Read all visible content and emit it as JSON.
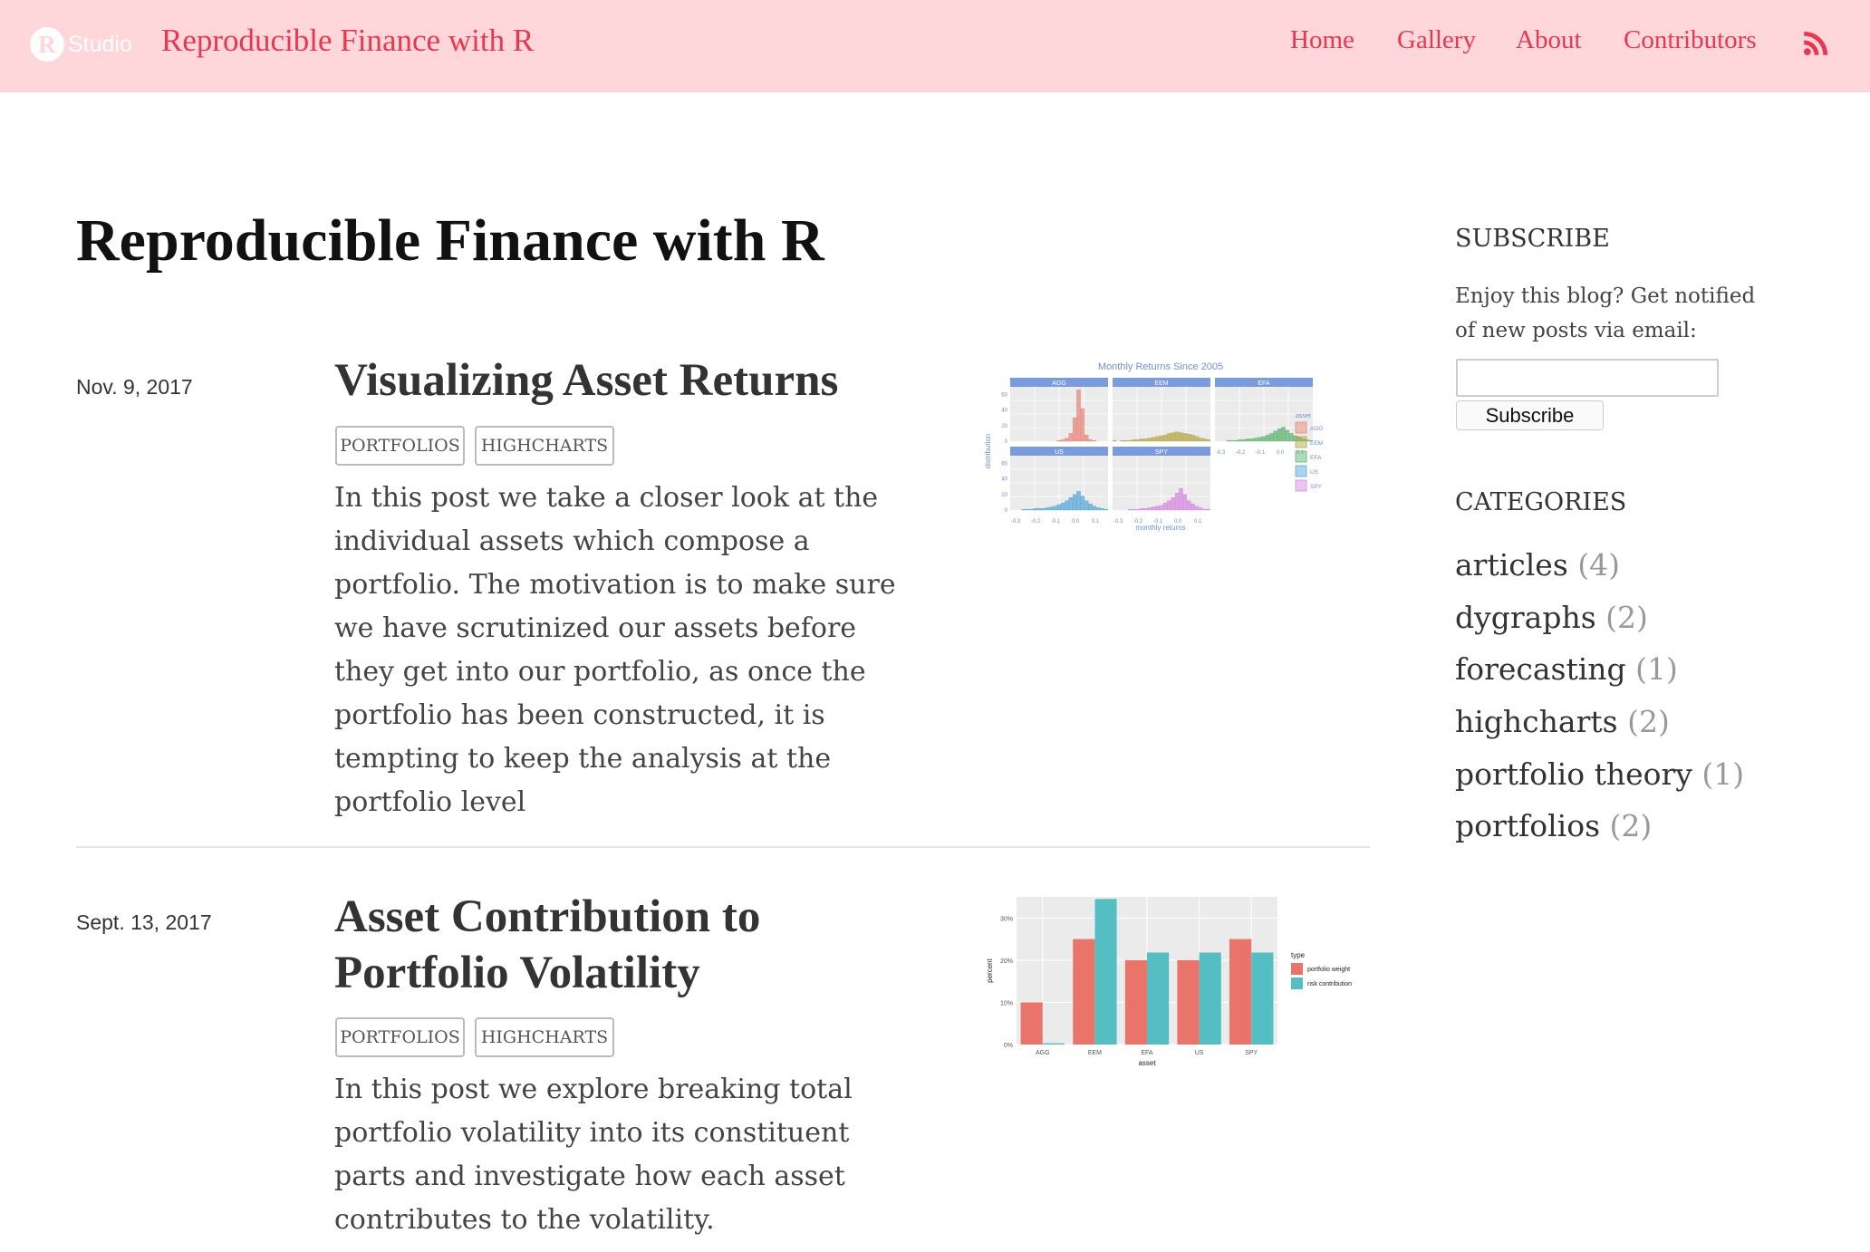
{
  "nav": {
    "logo_letter": "R",
    "logo_text": "Studio",
    "site_title": "Reproducible Finance with R",
    "links": [
      "Home",
      "Gallery",
      "About",
      "Contributors"
    ],
    "rss_icon": "rss-icon",
    "accent_color": "#e8384f",
    "background_color": "#ffd6da"
  },
  "main": {
    "heading": "Reproducible Finance with R",
    "posts": [
      {
        "date": "Nov. 9, 2017",
        "title": "Visualizing Asset Returns",
        "tags": [
          "PORTFOLIOS",
          "HIGHCHARTS"
        ],
        "summary": "In this post we take a closer look at the individual assets which compose a portfolio. The motivation is to make sure we have scrutinized our assets before they get into our portfolio, as once the portfolio has been constructed, it is tempting to keep the analysis at the portfolio level"
      },
      {
        "date": "Sept. 13, 2017",
        "title": "Asset Contribution to Portfolio Volatility",
        "tags": [
          "PORTFOLIOS",
          "HIGHCHARTS"
        ],
        "summary": "In this post we explore breaking total portfolio volatility into its constituent parts and investigate how each asset contributes to the volatility."
      }
    ]
  },
  "sidebar": {
    "subscribe_heading": "SUBSCRIBE",
    "subscribe_text": "Enjoy this blog? Get notified of new posts via email:",
    "subscribe_button": "Subscribe",
    "categories_heading": "CATEGORIES",
    "categories": [
      {
        "name": "articles",
        "count": "(4)"
      },
      {
        "name": "dygraphs",
        "count": "(2)"
      },
      {
        "name": "forecasting",
        "count": "(1)"
      },
      {
        "name": "highcharts",
        "count": "(2)"
      },
      {
        "name": "portfolio theory",
        "count": "(1)"
      },
      {
        "name": "portfolios",
        "count": "(2)"
      }
    ]
  },
  "chart_data": [
    {
      "type": "bar",
      "title": "Monthly Returns Since 2005",
      "xlabel": "monthly returns",
      "ylabel": "distribution",
      "panels": [
        "AGG",
        "EEM",
        "EFA",
        "US",
        "SPY"
      ],
      "x_ticks": [
        "-0.3",
        "-0.2",
        "-0.1",
        "0.0",
        "0.1"
      ],
      "y_ticks": [
        "0",
        "20",
        "40",
        "60"
      ],
      "legend_title": "asset",
      "series": [
        {
          "name": "AGG",
          "color": "#e8877c",
          "values": [
            0,
            0,
            0,
            0,
            0,
            0,
            0,
            0,
            0,
            0,
            0,
            0,
            1,
            2,
            4,
            10,
            30,
            66,
            42,
            8,
            2,
            1,
            0,
            0,
            0
          ]
        },
        {
          "name": "EEM",
          "color": "#b5a94a",
          "values": [
            1,
            0,
            1,
            1,
            1,
            2,
            2,
            3,
            3,
            4,
            5,
            6,
            7,
            8,
            10,
            11,
            12,
            11,
            10,
            9,
            8,
            6,
            4,
            3,
            2
          ]
        },
        {
          "name": "EFA",
          "color": "#62b670",
          "values": [
            0,
            0,
            0,
            1,
            1,
            1,
            2,
            2,
            3,
            3,
            4,
            5,
            6,
            8,
            10,
            13,
            16,
            18,
            14,
            10,
            7,
            5,
            3,
            2,
            1
          ]
        },
        {
          "name": "US",
          "color": "#5aa9d9",
          "values": [
            0,
            0,
            0,
            1,
            1,
            1,
            2,
            2,
            2,
            3,
            4,
            5,
            7,
            9,
            12,
            16,
            20,
            24,
            18,
            12,
            8,
            5,
            3,
            2,
            1
          ]
        },
        {
          "name": "SPY",
          "color": "#d58be0",
          "values": [
            0,
            0,
            0,
            0,
            1,
            1,
            1,
            2,
            2,
            3,
            4,
            5,
            6,
            9,
            12,
            16,
            22,
            28,
            20,
            12,
            8,
            5,
            3,
            1,
            1
          ]
        }
      ]
    },
    {
      "type": "bar",
      "xlabel": "asset",
      "ylabel": "percent",
      "categories": [
        "AGG",
        "EEM",
        "EFA",
        "US",
        "SPY"
      ],
      "y_ticks": [
        "0%",
        "10%",
        "20%",
        "30%"
      ],
      "ylim": [
        0,
        0.35
      ],
      "legend_title": "type",
      "series": [
        {
          "name": "portfolio weight",
          "color": "#e8746a",
          "values": [
            0.1,
            0.25,
            0.2,
            0.2,
            0.25
          ]
        },
        {
          "name": "risk contribution",
          "color": "#54bec3",
          "values": [
            0.003,
            0.345,
            0.218,
            0.218,
            0.218
          ]
        }
      ]
    }
  ]
}
